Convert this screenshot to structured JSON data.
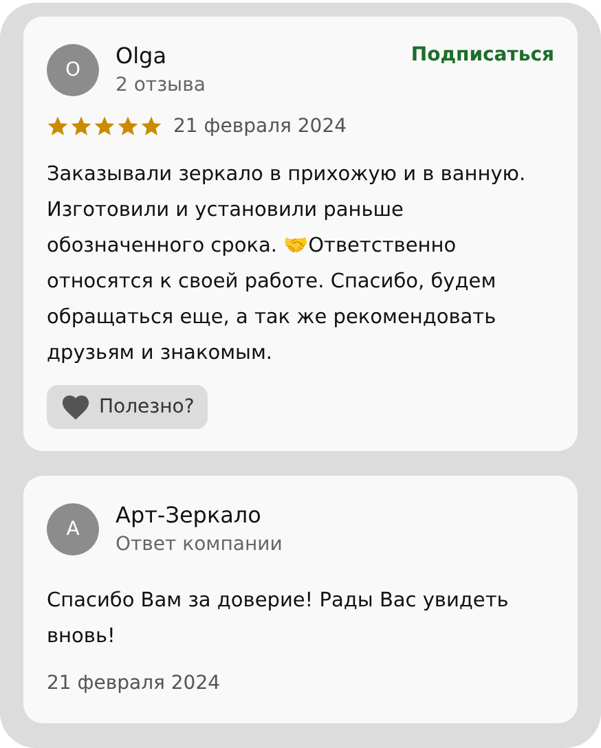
{
  "review": {
    "avatar_letter": "O",
    "author": "Olga",
    "review_count": "2 отзыва",
    "subscribe": "Подписаться",
    "stars": 5,
    "date": "21 февраля 2024",
    "text": "Заказывали зеркало в прихожую и в ванную. Изготовили и установили раньше обозначенного срока. 🤝Ответственно относятся к своей работе. Спасибо, будем обращаться еще, а так же рекомендовать друзьям и знакомым.",
    "helpful": {
      "label": "Полезно?",
      "selected": false
    }
  },
  "reply": {
    "avatar_letter": "А",
    "author": "Арт-Зеркало",
    "subtitle": "Ответ компании",
    "text": "Спасибо Вам за доверие! Рады Вас увидеть вновь!",
    "date": "21 февраля 2024"
  }
}
